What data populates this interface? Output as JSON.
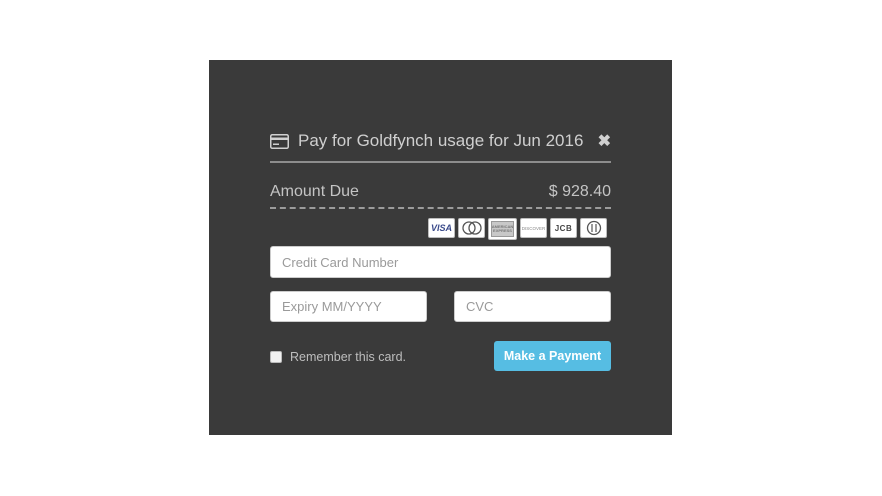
{
  "modal": {
    "title": "Pay for Goldfynch usage for Jun 2016",
    "close_symbol": "✖",
    "amount_label": "Amount Due",
    "amount_value": "$ 928.40",
    "card_logos": [
      {
        "name": "visa-logo",
        "text": "VISA"
      },
      {
        "name": "mastercard-logo",
        "text": ""
      },
      {
        "name": "amex-logo",
        "text": "AMERICAN EXPRESS"
      },
      {
        "name": "discover-logo",
        "text": "DISCOVER"
      },
      {
        "name": "jcb-logo",
        "text": "JCB"
      },
      {
        "name": "diners-logo",
        "text": ""
      }
    ],
    "card_number_placeholder": "Credit Card Number",
    "expiry_placeholder": "Expiry MM/YYYY",
    "cvc_placeholder": "CVC",
    "remember_label": "Remember this card.",
    "pay_button_label": "Make a Payment"
  },
  "colors": {
    "modal_bg": "#3a3a3a",
    "accent_button": "#56bde3",
    "focus_border": "#5a45a8"
  }
}
